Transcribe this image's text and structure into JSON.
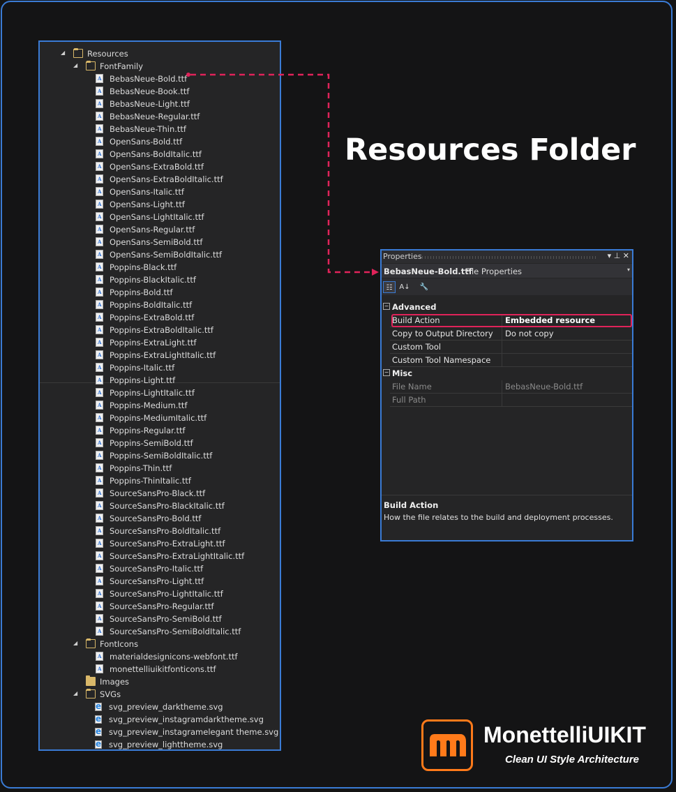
{
  "explorer": {
    "items": [
      {
        "label": "Resources",
        "kind": "folder-open",
        "level": 0,
        "expanded": true
      },
      {
        "label": "FontFamily",
        "kind": "folder-open",
        "level": 1,
        "expanded": true
      },
      {
        "label": "BebasNeue-Bold.ttf",
        "kind": "font",
        "level": 2
      },
      {
        "label": "BebasNeue-Book.ttf",
        "kind": "font",
        "level": 2
      },
      {
        "label": "BebasNeue-Light.ttf",
        "kind": "font",
        "level": 2
      },
      {
        "label": "BebasNeue-Regular.ttf",
        "kind": "font",
        "level": 2
      },
      {
        "label": "BebasNeue-Thin.ttf",
        "kind": "font",
        "level": 2
      },
      {
        "label": "OpenSans-Bold.ttf",
        "kind": "font",
        "level": 2
      },
      {
        "label": "OpenSans-BoldItalic.ttf",
        "kind": "font",
        "level": 2
      },
      {
        "label": "OpenSans-ExtraBold.ttf",
        "kind": "font",
        "level": 2
      },
      {
        "label": "OpenSans-ExtraBoldItalic.ttf",
        "kind": "font",
        "level": 2
      },
      {
        "label": "OpenSans-Italic.ttf",
        "kind": "font",
        "level": 2
      },
      {
        "label": "OpenSans-Light.ttf",
        "kind": "font",
        "level": 2
      },
      {
        "label": "OpenSans-LightItalic.ttf",
        "kind": "font",
        "level": 2
      },
      {
        "label": "OpenSans-Regular.ttf",
        "kind": "font",
        "level": 2
      },
      {
        "label": "OpenSans-SemiBold.ttf",
        "kind": "font",
        "level": 2
      },
      {
        "label": "OpenSans-SemiBoldItalic.ttf",
        "kind": "font",
        "level": 2
      },
      {
        "label": "Poppins-Black.ttf",
        "kind": "font",
        "level": 2
      },
      {
        "label": "Poppins-BlackItalic.ttf",
        "kind": "font",
        "level": 2
      },
      {
        "label": "Poppins-Bold.ttf",
        "kind": "font",
        "level": 2
      },
      {
        "label": "Poppins-BoldItalic.ttf",
        "kind": "font",
        "level": 2
      },
      {
        "label": "Poppins-ExtraBold.ttf",
        "kind": "font",
        "level": 2
      },
      {
        "label": "Poppins-ExtraBoldItalic.ttf",
        "kind": "font",
        "level": 2
      },
      {
        "label": "Poppins-ExtraLight.ttf",
        "kind": "font",
        "level": 2
      },
      {
        "label": "Poppins-ExtraLightItalic.ttf",
        "kind": "font",
        "level": 2
      },
      {
        "label": "Poppins-Italic.ttf",
        "kind": "font",
        "level": 2
      },
      {
        "label": "Poppins-Light.ttf",
        "kind": "font",
        "level": 2
      },
      {
        "label": "Poppins-LightItalic.ttf",
        "kind": "font",
        "level": 2
      },
      {
        "label": "Poppins-Medium.ttf",
        "kind": "font",
        "level": 2
      },
      {
        "label": "Poppins-MediumItalic.ttf",
        "kind": "font",
        "level": 2
      },
      {
        "label": "Poppins-Regular.ttf",
        "kind": "font",
        "level": 2
      },
      {
        "label": "Poppins-SemiBold.ttf",
        "kind": "font",
        "level": 2
      },
      {
        "label": "Poppins-SemiBoldItalic.ttf",
        "kind": "font",
        "level": 2
      },
      {
        "label": "Poppins-Thin.ttf",
        "kind": "font",
        "level": 2
      },
      {
        "label": "Poppins-ThinItalic.ttf",
        "kind": "font",
        "level": 2
      },
      {
        "label": "SourceSansPro-Black.ttf",
        "kind": "font",
        "level": 2
      },
      {
        "label": "SourceSansPro-BlackItalic.ttf",
        "kind": "font",
        "level": 2
      },
      {
        "label": "SourceSansPro-Bold.ttf",
        "kind": "font",
        "level": 2
      },
      {
        "label": "SourceSansPro-BoldItalic.ttf",
        "kind": "font",
        "level": 2
      },
      {
        "label": "SourceSansPro-ExtraLight.ttf",
        "kind": "font",
        "level": 2
      },
      {
        "label": "SourceSansPro-ExtraLightItalic.ttf",
        "kind": "font",
        "level": 2
      },
      {
        "label": "SourceSansPro-Italic.ttf",
        "kind": "font",
        "level": 2
      },
      {
        "label": "SourceSansPro-Light.ttf",
        "kind": "font",
        "level": 2
      },
      {
        "label": "SourceSansPro-LightItalic.ttf",
        "kind": "font",
        "level": 2
      },
      {
        "label": "SourceSansPro-Regular.ttf",
        "kind": "font",
        "level": 2
      },
      {
        "label": "SourceSansPro-SemiBold.ttf",
        "kind": "font",
        "level": 2
      },
      {
        "label": "SourceSansPro-SemiBoldItalic.ttf",
        "kind": "font",
        "level": 2
      },
      {
        "label": "FontIcons",
        "kind": "folder-open",
        "level": 1,
        "expanded": true
      },
      {
        "label": "materialdesignicons-webfont.ttf",
        "kind": "font",
        "level": 2
      },
      {
        "label": "monettelliuikitfonticons.ttf",
        "kind": "font",
        "level": 2
      },
      {
        "label": "Images",
        "kind": "folder",
        "level": 1,
        "expanded": false
      },
      {
        "label": "SVGs",
        "kind": "folder-open",
        "level": 1,
        "expanded": true
      },
      {
        "label": "svg_preview_darktheme.svg",
        "kind": "svg",
        "level": 2
      },
      {
        "label": "svg_preview_instagramdarktheme.svg",
        "kind": "svg",
        "level": 2
      },
      {
        "label": "svg_preview_instagramelegant theme.svg",
        "kind": "svg",
        "level": 2
      },
      {
        "label": "svg_preview_lighttheme.svg",
        "kind": "svg",
        "level": 2
      }
    ]
  },
  "heading": "Resources Folder",
  "properties": {
    "panel_title": "Properties",
    "header_icons": "▾ ⊥ ✕",
    "object_name": "BebasNeue-Bold.ttf",
    "object_kind": "File Properties",
    "dropdown_glyph": "▾",
    "toolbar": {
      "categorized_icon": "☷",
      "alpha_icon": "A↓",
      "pages_icon": "🔧"
    },
    "categories": [
      {
        "name": "Advanced",
        "toggle": "−",
        "rows": [
          {
            "name": "Build Action",
            "value": "Embedded resource",
            "highlight": true
          },
          {
            "name": "Copy to Output Directory",
            "value": "Do not copy"
          },
          {
            "name": "Custom Tool",
            "value": ""
          },
          {
            "name": "Custom Tool Namespace",
            "value": ""
          }
        ]
      },
      {
        "name": "Misc",
        "toggle": "−",
        "rows": [
          {
            "name": "File Name",
            "value": "BebasNeue-Bold.ttf",
            "disabled": true
          },
          {
            "name": "Full Path",
            "value": "",
            "disabled": true
          }
        ]
      }
    ],
    "description": {
      "title": "Build Action",
      "text": "How the file relates to the build and deployment processes."
    }
  },
  "brand": {
    "name": "MonettelliUIKIT",
    "tagline": "Clean UI Style Architecture",
    "accent_color": "#ff7a1a",
    "highlight_color": "#e0235a",
    "frame_color": "#3a7bd5"
  }
}
